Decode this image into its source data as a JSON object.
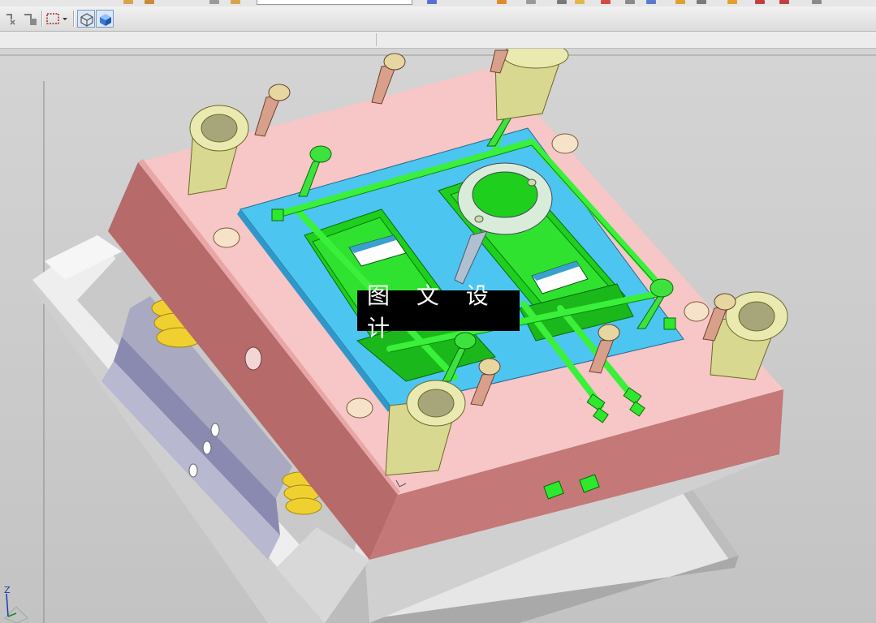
{
  "toolbar": {
    "icons": [
      "snap-point-icon",
      "snap-edge-icon",
      "selection-box-icon",
      "dropdown-arrow-icon",
      "wireframe-view-icon",
      "shaded-view-icon"
    ]
  },
  "viewport": {
    "watermark": "图 文 设 计",
    "triad_axis_label": "Z",
    "colors": {
      "cavity_plate": "#f5c2c2",
      "cavity_plate_side": "#b86a6a",
      "insert": "#48c8ea",
      "part": "#22cc22",
      "cooling_lines": "#33ee33",
      "guide_bushing": "#d8d890",
      "base_plate": "#d9d9d9"
    }
  }
}
